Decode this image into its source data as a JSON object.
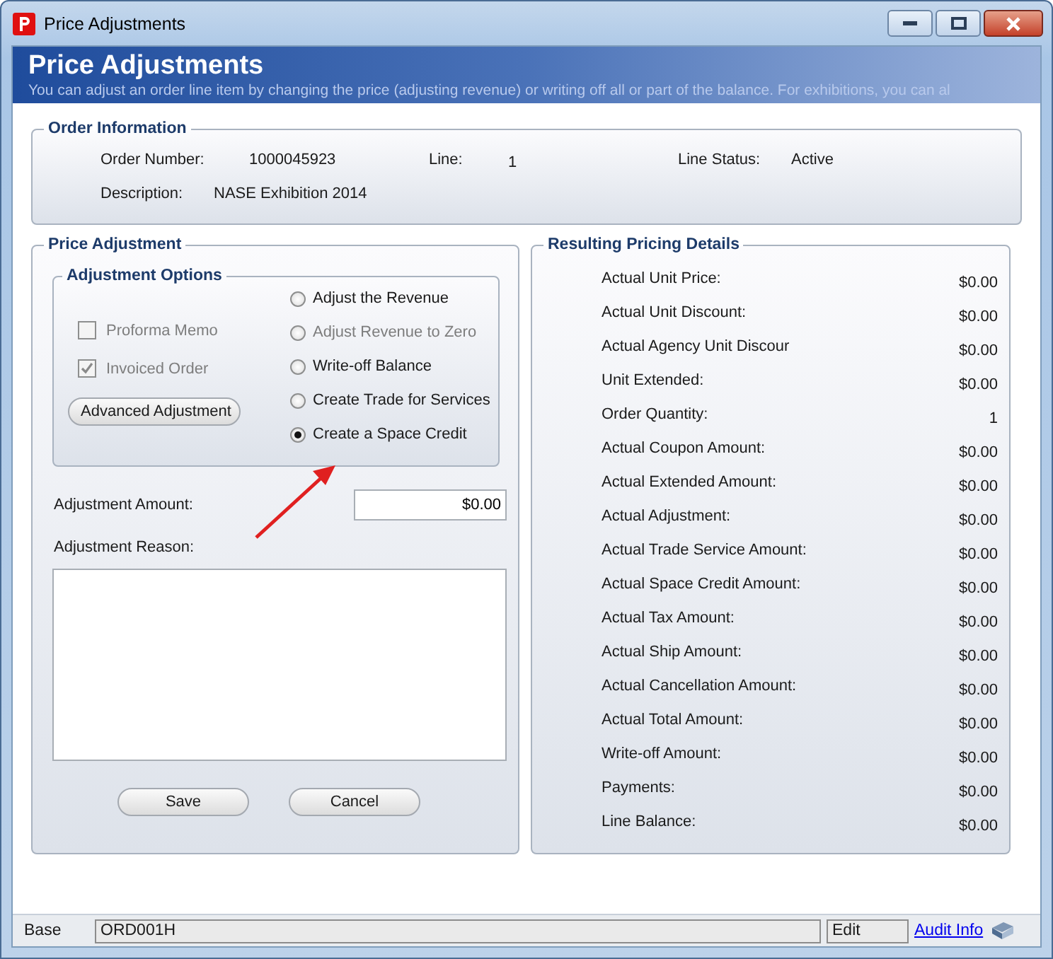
{
  "window": {
    "title": "Price Adjustments"
  },
  "header": {
    "title": "Price Adjustments",
    "subtitle": "You can adjust an order line item by changing the price (adjusting revenue) or writing off all or part of the balance. For exhibitions, you can al"
  },
  "order_information": {
    "legend": "Order Information",
    "fields": [
      {
        "label": "Order Number:",
        "value": "1000045923"
      },
      {
        "label": "Line:",
        "value": "1"
      },
      {
        "label": "Line Status:",
        "value": "Active"
      },
      {
        "label": "Description:",
        "value": "NASE Exhibition 2014"
      }
    ]
  },
  "price_adjustment": {
    "legend": "Price Adjustment",
    "adjustment_options": {
      "legend": "Adjustment Options",
      "checkboxes": [
        {
          "label": "Proforma Memo",
          "checked": false,
          "disabled": true
        },
        {
          "label": "Invoiced Order",
          "checked": true,
          "disabled": true
        }
      ],
      "advanced_button": "Advanced Adjustment",
      "radios": [
        {
          "label": "Adjust the Revenue",
          "selected": false,
          "disabled": false
        },
        {
          "label": "Adjust Revenue to Zero",
          "selected": false,
          "disabled": true
        },
        {
          "label": "Write-off Balance",
          "selected": false,
          "disabled": false
        },
        {
          "label": "Create Trade for Services",
          "selected": false,
          "disabled": false
        },
        {
          "label": "Create a Space Credit",
          "selected": true,
          "disabled": false
        }
      ]
    },
    "amount": {
      "label": "Adjustment Amount:",
      "value": "$0.00"
    },
    "reason": {
      "label": "Adjustment Reason:"
    },
    "buttons": [
      "Save",
      "Cancel"
    ]
  },
  "pricing_details": {
    "legend": "Resulting Pricing Details",
    "rows": [
      {
        "label": "Actual Unit Price:",
        "value": "$0.00"
      },
      {
        "label": "Actual Unit Discount:",
        "value": "$0.00"
      },
      {
        "label": "Actual Agency Unit Discour",
        "value": "$0.00"
      },
      {
        "label": "Unit Extended:",
        "value": "$0.00"
      },
      {
        "label": "Order Quantity:",
        "value": "1"
      },
      {
        "label": "Actual Coupon Amount:",
        "value": "$0.00"
      },
      {
        "label": "Actual Extended Amount:",
        "value": "$0.00"
      },
      {
        "label": "Actual Adjustment:",
        "value": "$0.00"
      },
      {
        "label": "Actual Trade Service Amount:",
        "value": "$0.00"
      },
      {
        "label": "Actual Space Credit Amount:",
        "value": "$0.00"
      },
      {
        "label": "Actual Tax Amount:",
        "value": "$0.00"
      },
      {
        "label": "Actual Ship Amount:",
        "value": "$0.00"
      },
      {
        "label": "Actual Cancellation Amount:",
        "value": "$0.00"
      },
      {
        "label": "Actual Total Amount:",
        "value": "$0.00"
      },
      {
        "label": "Write-off Amount:",
        "value": "$0.00"
      },
      {
        "label": "Payments:",
        "value": "$0.00"
      },
      {
        "label": "Line Balance:",
        "value": "$0.00"
      }
    ]
  },
  "status_bar": {
    "label": "Base",
    "form_code": "ORD001H",
    "mode": "Edit",
    "link": "Audit Info"
  }
}
